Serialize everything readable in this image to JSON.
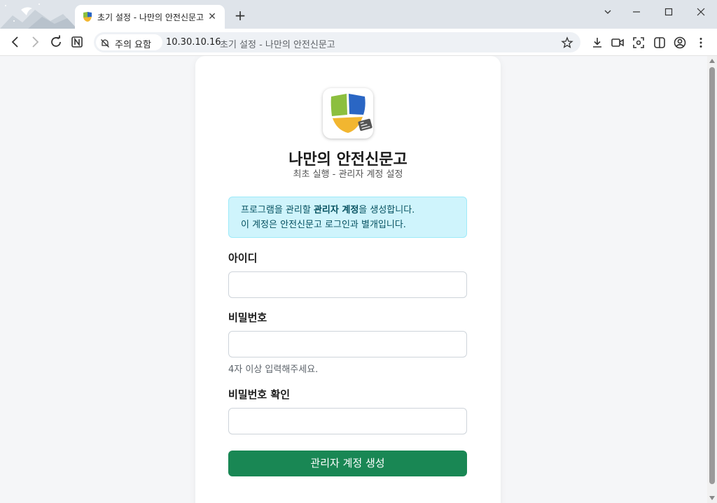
{
  "window": {
    "tab_title": "초기 설정 - 나만의 안전신문고",
    "tab_close": "✕",
    "new_tab": "+"
  },
  "toolbar": {
    "security_chip": "주의 요함",
    "url_host": "10.30.10.16",
    "url_page_title": "초기 설정 - 나만의 안전신문고"
  },
  "page": {
    "app_title": "나만의 안전신문고",
    "app_subtitle": "최초 실행 - 관리자 계정 설정",
    "alert": {
      "line1_prefix": "프로그램을 관리할 ",
      "line1_bold": "관리자 계정",
      "line1_suffix": "을 생성합니다.",
      "line2": "이 계정은 안전신문고 로그인과 별개입니다."
    },
    "form": {
      "username_label": "아이디",
      "username_value": "",
      "password_label": "비밀번호",
      "password_value": "",
      "password_hint": "4자 이상 입력해주세요.",
      "password_confirm_label": "비밀번호 확인",
      "password_confirm_value": "",
      "submit_label": "관리자 계정 생성"
    }
  },
  "colors": {
    "primary_button": "#198754",
    "alert_bg": "#cff4fc",
    "alert_text": "#055160",
    "logo_green": "#8cbf3f",
    "logo_blue": "#2a66c4",
    "logo_yellow": "#f2b630"
  }
}
